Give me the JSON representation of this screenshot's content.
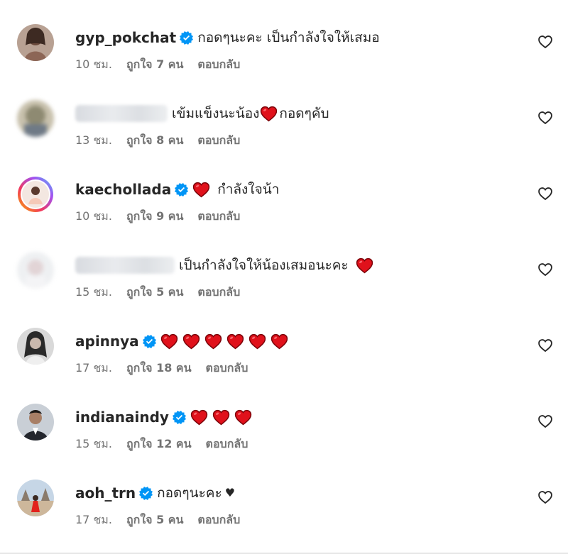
{
  "heart_color": "#e0111b",
  "verified_color": "#0095f6",
  "comments": [
    {
      "username": "gyp_pokchat",
      "verified": true,
      "text": "กอดๆนะคะ เป็นกำลังใจให้เสมอ",
      "time": "10 ชม.",
      "likes": "ถูกใจ 7 คน",
      "reply": "ตอบกลับ",
      "avatar_icon": "avatar-photo"
    },
    {
      "username": "",
      "verified": false,
      "text_before": "เข้มแข็งนะน้อง",
      "text_after": "กอดๆคับ",
      "time": "13 ชม.",
      "likes": "ถูกใจ 8 คน",
      "reply": "ตอบกลับ",
      "avatar_icon": "blurred-avatar"
    },
    {
      "username": "kaechollada",
      "verified": true,
      "text": "กำลังใจน้า",
      "time": "10 ชม.",
      "likes": "ถูกใจ 9 คน",
      "reply": "ตอบกลับ",
      "avatar_icon": "story-ring-avatar"
    },
    {
      "username": "",
      "verified": false,
      "text": "เป็นกำลังใจให้น้องเสมอนะคะ",
      "time": "15 ชม.",
      "likes": "ถูกใจ 5 คน",
      "reply": "ตอบกลับ",
      "avatar_icon": "blurred-avatar"
    },
    {
      "username": "apinnya",
      "verified": true,
      "heart_count": 6,
      "time": "17 ชม.",
      "likes": "ถูกใจ 18 คน",
      "reply": "ตอบกลับ",
      "avatar_icon": "avatar-photo"
    },
    {
      "username": "indianaindy",
      "verified": true,
      "heart_count": 3,
      "time": "15 ชม.",
      "likes": "ถูกใจ 12 คน",
      "reply": "ตอบกลับ",
      "avatar_icon": "avatar-photo"
    },
    {
      "username": "aoh_trn",
      "verified": true,
      "text": "กอดๆนะคะ",
      "suffix": "♥",
      "time": "17 ชม.",
      "likes": "ถูกใจ 5 คน",
      "reply": "ตอบกลับ",
      "avatar_icon": "avatar-photo"
    }
  ]
}
